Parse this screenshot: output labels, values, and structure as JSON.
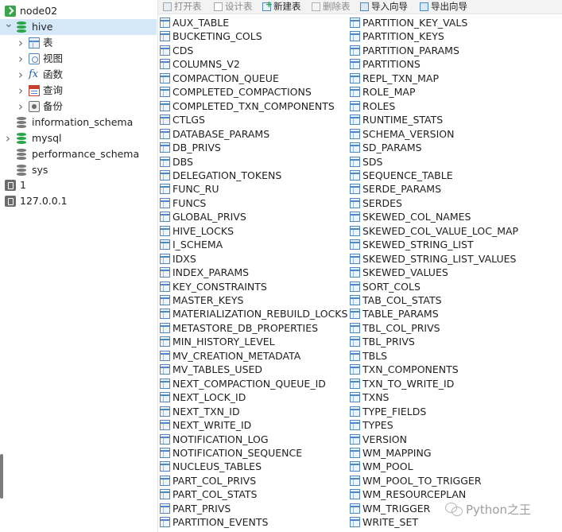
{
  "tree": [
    {
      "id": "node02",
      "label": "node02",
      "icon": "connection-green",
      "chevron": "",
      "selected": false
    },
    {
      "id": "hive",
      "label": "hive",
      "icon": "database-green",
      "chevron": "v",
      "selected": true
    },
    {
      "id": "tables",
      "label": "表",
      "icon": "table",
      "chevron": ">",
      "selected": false
    },
    {
      "id": "views",
      "label": "视图",
      "icon": "view",
      "chevron": ">",
      "selected": false
    },
    {
      "id": "functions",
      "label": "函数",
      "icon": "function",
      "chevron": ">",
      "selected": false
    },
    {
      "id": "queries",
      "label": "查询",
      "icon": "query",
      "chevron": ">",
      "selected": false
    },
    {
      "id": "backups",
      "label": "备份",
      "icon": "backup",
      "chevron": ">",
      "selected": false
    },
    {
      "id": "information_schema",
      "label": "information_schema",
      "icon": "database-gray",
      "chevron": "",
      "selected": false
    },
    {
      "id": "mysql",
      "label": "mysql",
      "icon": "database-green",
      "chevron": ">",
      "selected": false
    },
    {
      "id": "performance_schema",
      "label": "performance_schema",
      "icon": "database-gray",
      "chevron": "",
      "selected": false
    },
    {
      "id": "sys",
      "label": "sys",
      "icon": "database-gray",
      "chevron": "",
      "selected": false
    },
    {
      "id": "conn-1",
      "label": "1",
      "icon": "connection-gray",
      "chevron": "",
      "selected": false
    },
    {
      "id": "conn-127",
      "label": "127.0.0.1",
      "icon": "connection-gray",
      "chevron": "",
      "selected": false
    }
  ],
  "toolbar": {
    "open_table": "打开表",
    "design_table": "设计表",
    "new_table": "新建表",
    "delete_table": "删除表",
    "import_wizard": "导入向导",
    "export_wizard": "导出向导"
  },
  "tables_col1": [
    "AUX_TABLE",
    "BUCKETING_COLS",
    "CDS",
    "COLUMNS_V2",
    "COMPACTION_QUEUE",
    "COMPLETED_COMPACTIONS",
    "COMPLETED_TXN_COMPONENTS",
    "CTLGS",
    "DATABASE_PARAMS",
    "DB_PRIVS",
    "DBS",
    "DELEGATION_TOKENS",
    "FUNC_RU",
    "FUNCS",
    "GLOBAL_PRIVS",
    "HIVE_LOCKS",
    "I_SCHEMA",
    "IDXS",
    "INDEX_PARAMS",
    "KEY_CONSTRAINTS",
    "MASTER_KEYS",
    "MATERIALIZATION_REBUILD_LOCKS",
    "METASTORE_DB_PROPERTIES",
    "MIN_HISTORY_LEVEL",
    "MV_CREATION_METADATA",
    "MV_TABLES_USED",
    "NEXT_COMPACTION_QUEUE_ID",
    "NEXT_LOCK_ID",
    "NEXT_TXN_ID",
    "NEXT_WRITE_ID",
    "NOTIFICATION_LOG",
    "NOTIFICATION_SEQUENCE",
    "NUCLEUS_TABLES",
    "PART_COL_PRIVS",
    "PART_COL_STATS",
    "PART_PRIVS",
    "PARTITION_EVENTS"
  ],
  "tables_col2": [
    "PARTITION_KEY_VALS",
    "PARTITION_KEYS",
    "PARTITION_PARAMS",
    "PARTITIONS",
    "REPL_TXN_MAP",
    "ROLE_MAP",
    "ROLES",
    "RUNTIME_STATS",
    "SCHEMA_VERSION",
    "SD_PARAMS",
    "SDS",
    "SEQUENCE_TABLE",
    "SERDE_PARAMS",
    "SERDES",
    "SKEWED_COL_NAMES",
    "SKEWED_COL_VALUE_LOC_MAP",
    "SKEWED_STRING_LIST",
    "SKEWED_STRING_LIST_VALUES",
    "SKEWED_VALUES",
    "SORT_COLS",
    "TAB_COL_STATS",
    "TABLE_PARAMS",
    "TBL_COL_PRIVS",
    "TBL_PRIVS",
    "TBLS",
    "TXN_COMPONENTS",
    "TXN_TO_WRITE_ID",
    "TXNS",
    "TYPE_FIELDS",
    "TYPES",
    "VERSION",
    "WM_MAPPING",
    "WM_POOL",
    "WM_POOL_TO_TRIGGER",
    "WM_RESOURCEPLAN",
    "WM_TRIGGER",
    "WRITE_SET"
  ],
  "watermark": "Python之王"
}
